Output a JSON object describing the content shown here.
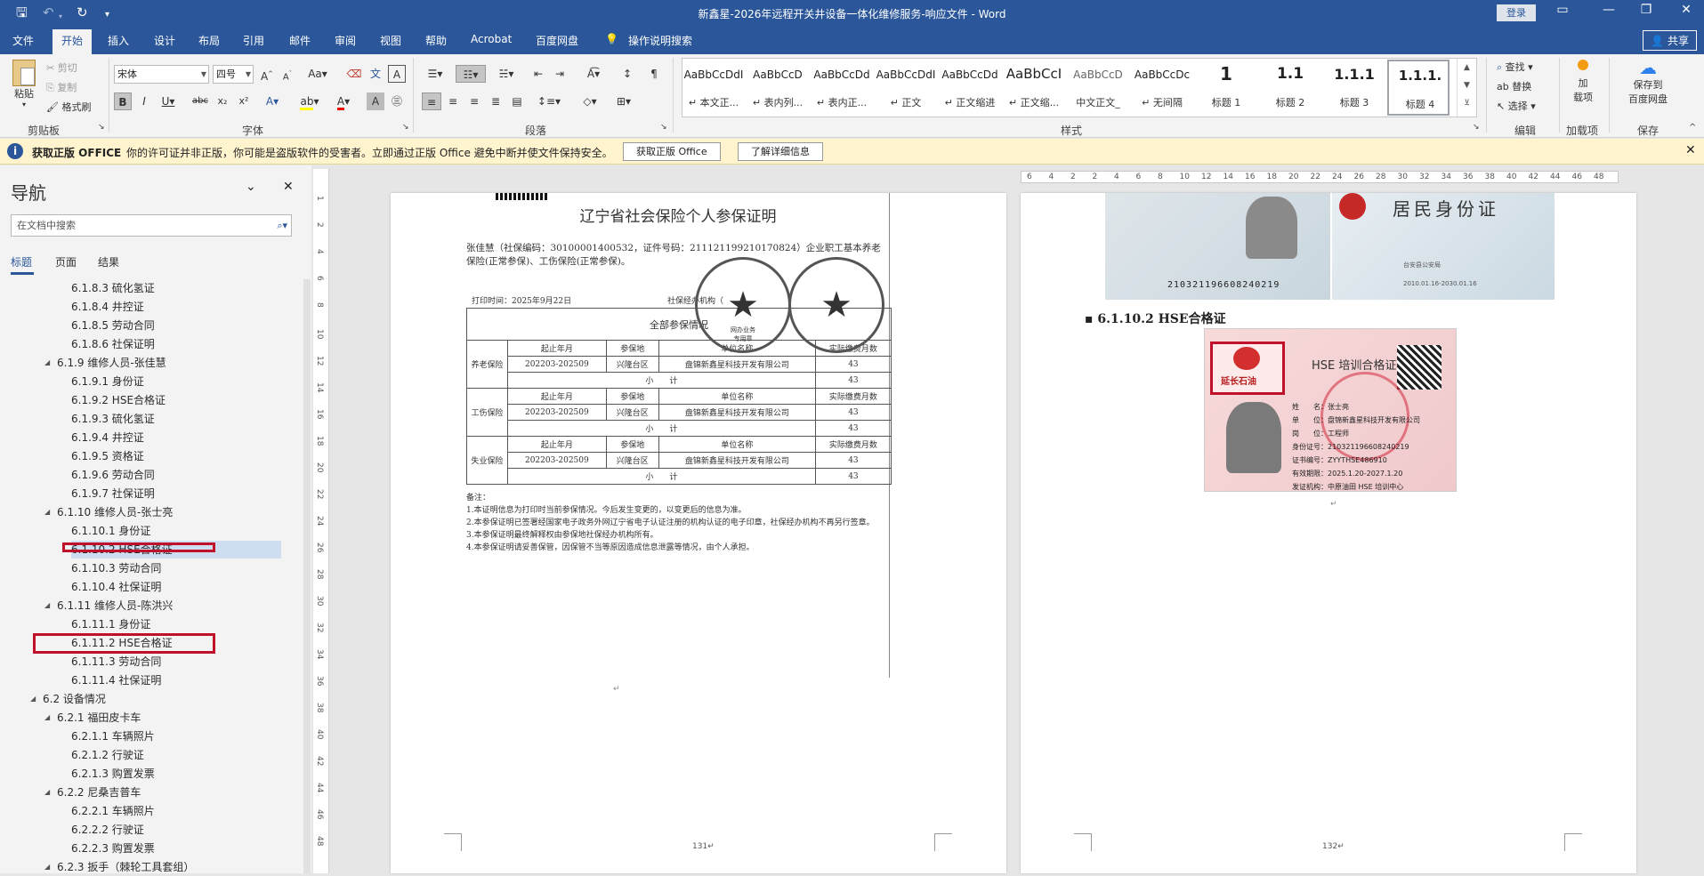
{
  "titlebar": {
    "title": "新鑫星-2026年远程开关井设备一体化维修服务-响应文件 - Word",
    "login": "登录"
  },
  "tabs": [
    "文件",
    "开始",
    "插入",
    "设计",
    "布局",
    "引用",
    "邮件",
    "审阅",
    "视图",
    "帮助",
    "Acrobat",
    "百度网盘"
  ],
  "tell_me": "操作说明搜索",
  "share": "共享",
  "ribbon": {
    "clipboard": {
      "paste": "粘贴",
      "cut": "剪切",
      "copy": "复制",
      "format_painter": "格式刷",
      "label": "剪贴板"
    },
    "font": {
      "name": "宋体",
      "size": "四号",
      "label": "字体"
    },
    "paragraph": {
      "label": "段落"
    },
    "styles": {
      "label": "样式",
      "tiles": [
        {
          "preview": "AaBbCcDdI",
          "name": "↵ 本文正..."
        },
        {
          "preview": "AaBbCcD",
          "name": "↵ 表内列..."
        },
        {
          "preview": "AaBbCcDd",
          "name": "↵ 表内正..."
        },
        {
          "preview": "AaBbCcDdI",
          "name": "↵ 正文"
        },
        {
          "preview": "AaBbCcDd",
          "name": "↵ 正文缩进"
        },
        {
          "preview": "AaBbCcI",
          "name": "↵ 正文缩..."
        },
        {
          "preview": "AaBbCcD",
          "name": "中文正文_"
        },
        {
          "preview": "AaBbCcDc",
          "name": "↵ 无间隔"
        },
        {
          "preview": "1",
          "name": "标题 1"
        },
        {
          "preview": "1.1",
          "name": "标题 2"
        },
        {
          "preview": "1.1.1",
          "name": "标题 3"
        },
        {
          "preview": "1.1.1.",
          "name": "标题 4"
        }
      ]
    },
    "editing": {
      "find": "查找",
      "replace": "替换",
      "select": "选择",
      "label": "编辑"
    },
    "addins": {
      "add": "加\n载项",
      "label": "加载项"
    },
    "save": {
      "save_baidu": "保存到\n百度网盘",
      "label": "保存"
    }
  },
  "infobar": {
    "title": "获取正版 OFFICE",
    "message": "你的许可证并非正版，你可能是盗版软件的受害者。立即通过正版 Office 避免中断并使文件保持安全。",
    "btn1": "获取正版 Office",
    "btn2": "了解详细信息"
  },
  "nav": {
    "title": "导航",
    "search_placeholder": "在文档中搜索",
    "tabs": [
      "标题",
      "页面",
      "结果"
    ],
    "items": [
      {
        "text": "6.1.8.3 硫化氢证",
        "level": 4
      },
      {
        "text": "6.1.8.4 井控证",
        "level": 4
      },
      {
        "text": "6.1.8.5 劳动合同",
        "level": 4
      },
      {
        "text": "6.1.8.6 社保证明",
        "level": 4
      },
      {
        "text": "6.1.9 维修人员-张佳慧",
        "level": 3
      },
      {
        "text": "6.1.9.1 身份证",
        "level": 4
      },
      {
        "text": "6.1.9.2 HSE合格证",
        "level": 4
      },
      {
        "text": "6.1.9.3 硫化氢证",
        "level": 4
      },
      {
        "text": "6.1.9.4 井控证",
        "level": 4
      },
      {
        "text": "6.1.9.5 资格证",
        "level": 4
      },
      {
        "text": "6.1.9.6 劳动合同",
        "level": 4
      },
      {
        "text": "6.1.9.7 社保证明",
        "level": 4
      },
      {
        "text": "6.1.10 维修人员-张士亮",
        "level": 3
      },
      {
        "text": "6.1.10.1 身份证",
        "level": 4
      },
      {
        "text": "6.1.10.2 HSE合格证",
        "level": 4
      },
      {
        "text": "6.1.10.3 劳动合同",
        "level": 4
      },
      {
        "text": "6.1.10.4 社保证明",
        "level": 4
      },
      {
        "text": "6.1.11 维修人员-陈洪兴",
        "level": 3
      },
      {
        "text": "6.1.11.1 身份证",
        "level": 4
      },
      {
        "text": "6.1.11.2 HSE合格证",
        "level": 4
      },
      {
        "text": "6.1.11.3 劳动合同",
        "level": 4
      },
      {
        "text": "6.1.11.4 社保证明",
        "level": 4
      },
      {
        "text": "6.2 设备情况",
        "level": 2
      },
      {
        "text": "6.2.1 福田皮卡车",
        "level": 3
      },
      {
        "text": "6.2.1.1 车辆照片",
        "level": 4
      },
      {
        "text": "6.2.1.2 行驶证",
        "level": 4
      },
      {
        "text": "6.2.1.3 购置发票",
        "level": 4
      },
      {
        "text": "6.2.2 尼桑吉普车",
        "level": 3
      },
      {
        "text": "6.2.2.1 车辆照片",
        "level": 4
      },
      {
        "text": "6.2.2.2 行驶证",
        "level": 4
      },
      {
        "text": "6.2.2.3 购置发票",
        "level": 4
      },
      {
        "text": "6.2.3 扳手（棘轮工具套组）",
        "level": 3
      }
    ]
  },
  "page1": {
    "cert_title": "辽宁省社会保险个人参保证明",
    "intro": "张佳慧（社保编码：30100001400532，证件号码：211121199210170824）企业职工基本养老保险(正常参保)、工伤保险(正常参保)。",
    "print_time": "打印时间：2025年9月22日",
    "agency": "社保经办机构（",
    "table_title": "全部参保情况",
    "headers": [
      "起止年月",
      "参保地",
      "单位名称",
      "实际缴费月数"
    ],
    "rows": [
      {
        "type": "养老保险",
        "period": "202203-202509",
        "place": "兴隆台区",
        "unit": "盘锦新鑫星科技开发有限公司",
        "months": "43"
      },
      {
        "type": "工伤保险",
        "period": "202203-202509",
        "place": "兴隆台区",
        "unit": "盘锦新鑫星科技开发有限公司",
        "months": "43"
      },
      {
        "type": "失业保险",
        "period": "202203-202509",
        "place": "兴隆台区",
        "unit": "盘锦新鑫星科技开发有限公司",
        "months": "43"
      }
    ],
    "subtotal_label": "小　　计",
    "notes_title": "备注：",
    "notes": [
      "1.本证明信息为打印时当前参保情况。今后发生变更的，以变更后的信息为准。",
      "2.本参保证明已签署经国家电子政务外网辽宁省电子认证注册的机构认证的电子印章，社保经办机构不再另行签章。",
      "3.本参保证明最终解释权由参保地社保经办机构所有。",
      "4.本参保证明请妥善保管，因保管不当等原因造成信息泄露等情况，由个人承担。"
    ],
    "stamp1_small": "网办业务\n专用章",
    "page_no": "131↵"
  },
  "page2": {
    "id_title": "居民身份证",
    "id_number": "21032119660824021​9",
    "id_issuer": "台安县公安局",
    "id_valid": "2010.01.16-2030.01.16",
    "heading": "6.1.10.2 HSE合格证",
    "hse_title": "HSE 培训合格证",
    "hse_lines": [
      "姓　　名：张士亮",
      "单　　位：盘锦新鑫星科技开发有限公司",
      "岗　　位：工程师",
      "身份证号：210321196608240219",
      "证书编号：ZYYTHSE486910",
      "有效期限：2025.1.20-2027.1.20",
      "发证机构：中原油田 HSE 培训中心"
    ],
    "logo_text": "延长石油",
    "page_no": "132↵"
  },
  "ruler": {
    "h_ticks": [
      "6",
      "4",
      "2",
      "2",
      "4",
      "6",
      "8",
      "10",
      "12",
      "14",
      "16",
      "18",
      "20",
      "22",
      "24",
      "26",
      "28",
      "30",
      "32",
      "34",
      "36",
      "38",
      "40",
      "42",
      "44",
      "46",
      "48"
    ],
    "v_ticks": [
      "1",
      "2",
      "4",
      "6",
      "8",
      "10",
      "12",
      "14",
      "16",
      "18",
      "20",
      "22",
      "24",
      "26",
      "28",
      "30",
      "32",
      "34",
      "36",
      "38",
      "40",
      "42",
      "44",
      "46",
      "48"
    ]
  }
}
